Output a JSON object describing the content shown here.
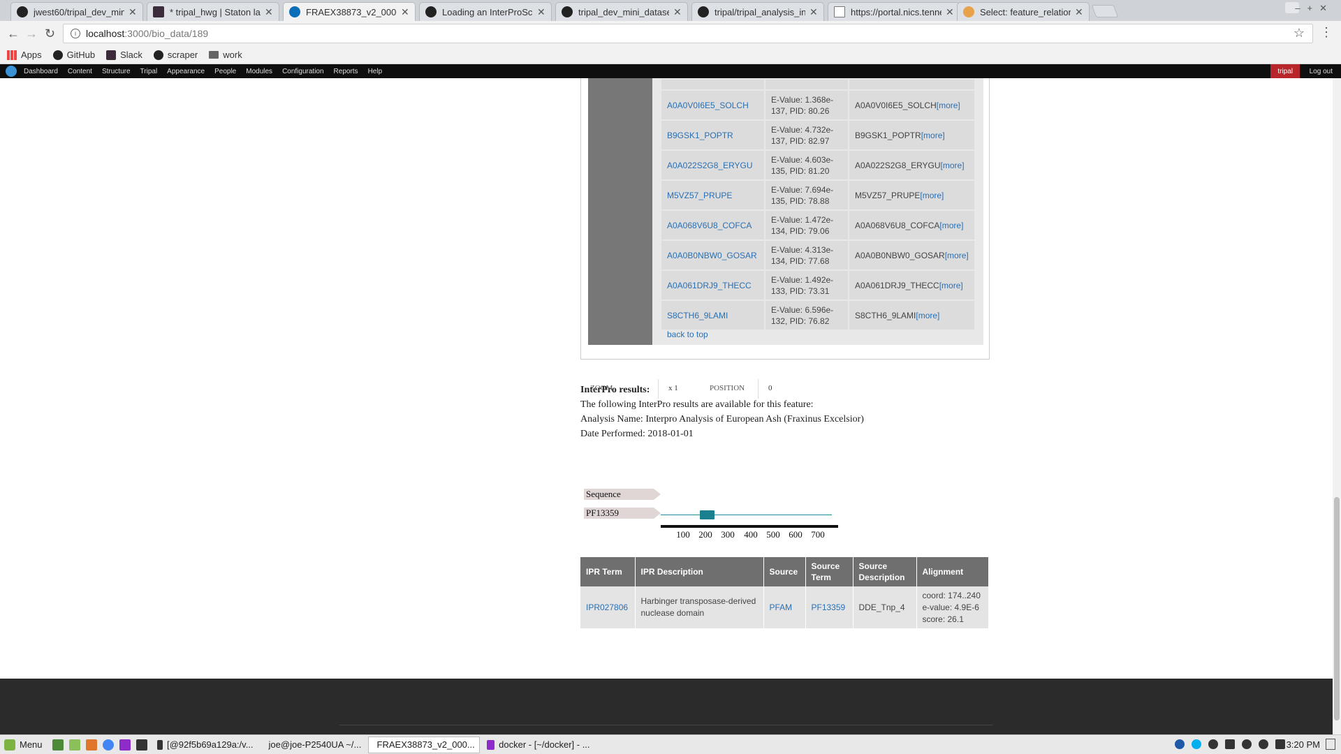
{
  "browser": {
    "tabs": [
      {
        "title": "jwest60/tripal_dev_mini",
        "favicon": "github-icon"
      },
      {
        "title": "* tripal_hwg | Staton lab",
        "favicon": "slack-icon"
      },
      {
        "title": "FRAEX38873_v2_00000",
        "favicon": "drupal-icon"
      },
      {
        "title": "Loading an InterProScan",
        "favicon": "github-icon"
      },
      {
        "title": "tripal_dev_mini_dataset",
        "favicon": "github-icon"
      },
      {
        "title": "tripal/tripal_analysis_in",
        "favicon": "github-icon"
      },
      {
        "title": "https://portal.nics.tenne",
        "favicon": "document-icon"
      },
      {
        "title": "Select: feature_relation",
        "favicon": "select-icon"
      }
    ],
    "url_host": "localhost",
    "url_path": ":3000/bio_data/189",
    "bookmarks": [
      "Apps",
      "GitHub",
      "Slack",
      "scraper",
      "work"
    ]
  },
  "adminbar": {
    "items": [
      "Dashboard",
      "Content",
      "Structure",
      "Tripal",
      "Appearance",
      "People",
      "Modules",
      "Configuration",
      "Reports",
      "Help"
    ],
    "user": "tripal",
    "logout": "Log out"
  },
  "blast": {
    "rows": [
      {
        "hit": "A0A0V0I6E5_SOLCH",
        "evalue_line1": "E-Value: 1.368e-",
        "evalue_line2": "137, PID: 80.26",
        "desc": "A0A0V0I6E5_SOLCH",
        "more": "[more]"
      },
      {
        "hit": "B9GSK1_POPTR",
        "evalue_line1": "E-Value: 4.732e-",
        "evalue_line2": "137, PID: 82.97",
        "desc": "B9GSK1_POPTR",
        "more": "[more]"
      },
      {
        "hit": "A0A022S2G8_ERYGU",
        "evalue_line1": "E-Value: 4.603e-",
        "evalue_line2": "135, PID: 81.20",
        "desc": "A0A022S2G8_ERYGU",
        "more": "[more]"
      },
      {
        "hit": "M5VZ57_PRUPE",
        "evalue_line1": "E-Value: 7.694e-",
        "evalue_line2": "135, PID: 78.88",
        "desc": "M5VZ57_PRUPE",
        "more": "[more]"
      },
      {
        "hit": "A0A068V6U8_COFCA",
        "evalue_line1": "E-Value: 1.472e-",
        "evalue_line2": "134, PID: 79.06",
        "desc": "A0A068V6U8_COFCA",
        "more": "[more]"
      },
      {
        "hit": "A0A0B0NBW0_GOSAR",
        "evalue_line1": "E-Value: 4.313e-",
        "evalue_line2": "134, PID: 77.68",
        "desc": "A0A0B0NBW0_GOSAR",
        "more": "[more]"
      },
      {
        "hit": "A0A061DRJ9_THECC",
        "evalue_line1": "E-Value: 1.492e-",
        "evalue_line2": "133, PID: 73.31",
        "desc": "A0A061DRJ9_THECC",
        "more": "[more]"
      },
      {
        "hit": "S8CTH6_9LAMI",
        "evalue_line1": "E-Value: 6.596e-",
        "evalue_line2": "132, PID: 76.82",
        "desc": "S8CTH6_9LAMI",
        "more": "[more]"
      }
    ],
    "back_to_top": "back to top"
  },
  "interpro": {
    "heading": "InterPro results:",
    "intro": "The following InterPro results are available for this feature:",
    "analysis": "Analysis Name: Interpro Analysis of European Ash (Fraxinus Excelsior)",
    "date": "Date Performed: 2018-01-01",
    "viewer": {
      "zoom_label": "ZOOM",
      "zoom_value": "x 1",
      "position_label": "POSITION",
      "position_value": "0",
      "tracks": [
        "Sequence",
        "PF13359"
      ],
      "axis_ticks": [
        "100",
        "200",
        "300",
        "400",
        "500",
        "600",
        "700"
      ]
    },
    "table": {
      "headers": [
        "IPR Term",
        "IPR Description",
        "Source",
        "Source Term",
        "Source Description",
        "Alignment"
      ],
      "row": {
        "ipr_term": "IPR027806",
        "ipr_desc": "Harbinger transposase-derived nuclease domain",
        "source": "PFAM",
        "source_term": "PF13359",
        "source_desc": "DDE_Tnp_4",
        "align_coord": "coord: 174..240",
        "align_evalue": "e-value: 4.9E-6",
        "align_score": "score: 26.1"
      }
    }
  },
  "taskbar": {
    "menu": "Menu",
    "tasks": [
      "[@92f5b69a129a:/v...",
      "joe@joe-P2540UA ~/...",
      "FRAEX38873_v2_000...",
      "docker - [~/docker] - ..."
    ],
    "clock": "3:20 PM"
  }
}
